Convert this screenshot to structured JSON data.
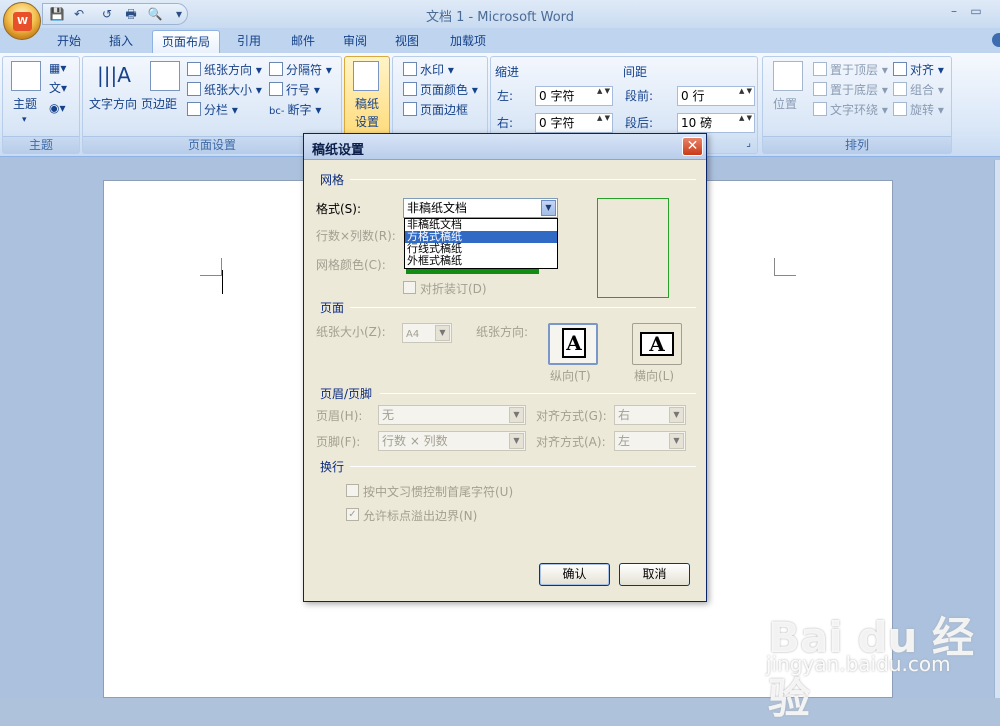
{
  "window": {
    "title": "文档 1 - Microsoft Word",
    "minimize": "–",
    "restore": "▭"
  },
  "office_button": {
    "logo": "W"
  },
  "qat": {
    "save": "💾",
    "undo": "↶",
    "redo": "↺",
    "print": "🖶",
    "preview": "🔍",
    "more": "▾"
  },
  "tabs": [
    "开始",
    "插入",
    "页面布局",
    "引用",
    "邮件",
    "审阅",
    "视图",
    "加载项"
  ],
  "active_tab": "页面布局",
  "ribbon": {
    "theme_group": {
      "label": "主题",
      "themes_btn": "主题",
      "colors_icon": "▦▾",
      "fonts_icon": "文▾",
      "effects_icon": "◉▾",
      "dropdown_arrow": "▾"
    },
    "page_setup_group": {
      "label": "页面设置",
      "text_direction": "文字方向",
      "margins": "页边距",
      "orientation": "纸张方向",
      "size": "纸张大小",
      "columns": "分栏",
      "breaks": "分隔符",
      "line_numbers": "行号",
      "hyphenation": "断字",
      "more_arrow": "▾",
      "hyphen_icon": "bc-"
    },
    "manuscript_group": {
      "btn_line1": "稿纸",
      "btn_line2": "设置"
    },
    "page_bg_group": {
      "watermark": "水印",
      "page_color": "页面颜色",
      "page_borders": "页面边框",
      "more_arrow": "▾"
    },
    "paragraph_group": {
      "indent_header": "缩进",
      "indent_left_label": "左:",
      "indent_left_value": "0 字符",
      "indent_right_label": "右:",
      "indent_right_value": "0 字符",
      "spacing_header": "间距",
      "before_label": "段前:",
      "before_value": "0 行",
      "after_label": "段后:",
      "after_value": "10 磅",
      "launcher": "⌟",
      "spin_arrows": "▲ ▼"
    },
    "arrange_group": {
      "label": "排列",
      "position": "位置",
      "bring_front": "置于顶层",
      "send_back": "置于底层",
      "text_wrap": "文字环绕",
      "align": "对齐",
      "group": "组合",
      "rotate": "旋转",
      "more_arrow": "▾"
    }
  },
  "dialog": {
    "title": "稿纸设置",
    "close": "✕",
    "grid_section": "网格",
    "style_label": "格式(S):",
    "style_value": "非稿纸文档",
    "style_options": [
      "非稿纸文档",
      "方格式稿纸",
      "行线式稿纸",
      "外框式稿纸"
    ],
    "style_highlight": "方格式稿纸",
    "rows_cols_label": "行数×列数(R):",
    "grid_color_label": "网格颜色(C):",
    "fold_label": "对折装订(D)",
    "page_section": "页面",
    "paper_size_label": "纸张大小(Z):",
    "paper_size_value": "A4",
    "orientation_label": "纸张方向:",
    "portrait_label": "纵向(T)",
    "landscape_label": "横向(L)",
    "orient_glyph": "A",
    "header_footer_section": "页眉/页脚",
    "header_label": "页眉(H):",
    "header_value": "无",
    "header_align_label": "对齐方式(G):",
    "header_align_value": "右",
    "footer_label": "页脚(F):",
    "footer_value": "行数 × 列数",
    "footer_align_label": "对齐方式(A):",
    "footer_align_value": "左",
    "linebreak_section": "换行",
    "chinese_rule_label": "按中文习惯控制首尾字符(U)",
    "allow_punct_label": "允许标点溢出边界(N)",
    "allow_punct_checked": true,
    "check_mark": "✓",
    "combo_arrow": "▼",
    "ok": "确认",
    "cancel": "取消",
    "grid_color_hex": "#128c12"
  },
  "watermark": {
    "line1": "Bai du 经验",
    "line2": "jingyan.baidu.com"
  }
}
